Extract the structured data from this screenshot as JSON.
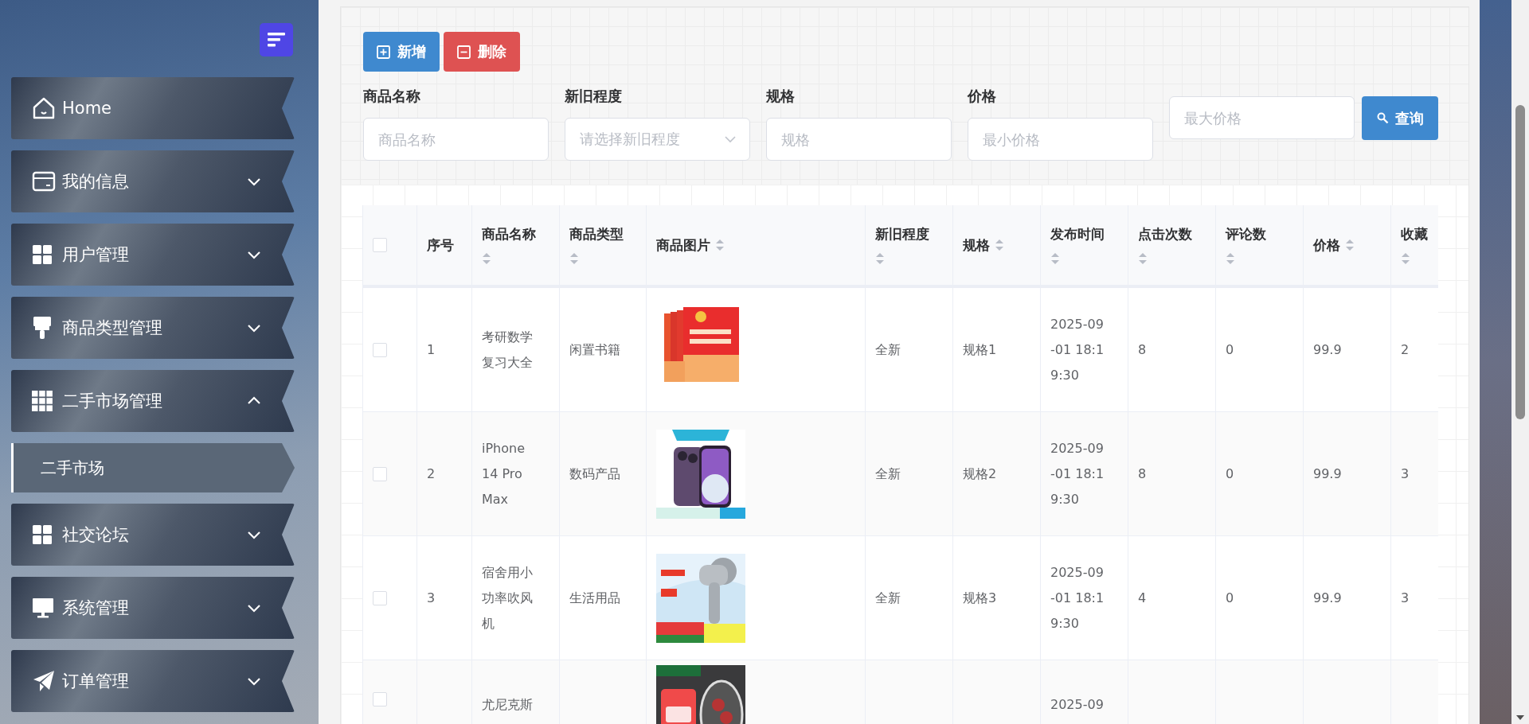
{
  "sidebar": {
    "menu": [
      {
        "label": "Home",
        "kind": "link"
      },
      {
        "label": "我的信息",
        "kind": "submenu",
        "expanded": false
      },
      {
        "label": "用户管理",
        "kind": "submenu",
        "expanded": false
      },
      {
        "label": "商品类型管理",
        "kind": "submenu",
        "expanded": false
      },
      {
        "label": "二手市场管理",
        "kind": "submenu",
        "expanded": true,
        "children": [
          {
            "label": "二手市场",
            "selected": true
          }
        ]
      },
      {
        "label": "社交论坛",
        "kind": "submenu",
        "expanded": false
      },
      {
        "label": "系统管理",
        "kind": "submenu",
        "expanded": false
      },
      {
        "label": "订单管理",
        "kind": "submenu",
        "expanded": false
      }
    ]
  },
  "toolbar": {
    "buttons": [
      {
        "label": "新增",
        "kind": "add"
      },
      {
        "label": "删除",
        "kind": "delete"
      }
    ]
  },
  "filters": [
    {
      "label": "商品名称",
      "placeholder": "商品名称",
      "kind": "text"
    },
    {
      "label": "新旧程度",
      "placeholder": "请选择新旧程度",
      "kind": "select"
    },
    {
      "label": "规格",
      "placeholder": "规格",
      "kind": "text"
    },
    {
      "label": "价格",
      "placeholder": "最小价格",
      "kind": "text"
    },
    {
      "placeholder": "最大价格",
      "kind": "text"
    }
  ],
  "search_button": "查询",
  "table": {
    "all_selected": false,
    "columns": [
      {
        "label": "序号",
        "sortable": false
      },
      {
        "label": "商品名称",
        "sortable": true
      },
      {
        "label": "商品类型",
        "sortable": true
      },
      {
        "label": "商品图片",
        "sortable": true
      },
      {
        "label": "新旧程度",
        "sortable": true
      },
      {
        "label": "规格",
        "sortable": true
      },
      {
        "label": "发布时间",
        "sortable": true
      },
      {
        "label": "点击次数",
        "sortable": true
      },
      {
        "label": "评论数",
        "sortable": true
      },
      {
        "label": "价格",
        "sortable": true
      },
      {
        "label": "收藏",
        "sortable": true
      }
    ],
    "rows": [
      {
        "selected": false,
        "cells": [
          "1",
          "考研数学复习大全",
          "闲置书籍",
          {
            "kind": "picture"
          },
          "全新",
          "规格1",
          "2025-09-01 18:19:30",
          "8",
          "0",
          "99.9",
          "2"
        ]
      },
      {
        "selected": false,
        "cells": [
          "2",
          "iPhone 14 Pro Max",
          "数码产品",
          {
            "kind": "picture"
          },
          "全新",
          "规格2",
          "2025-09-01 18:19:30",
          "8",
          "0",
          "99.9",
          "3"
        ]
      },
      {
        "selected": false,
        "cells": [
          "3",
          "宿舍用小功率吹风机",
          "生活用品",
          {
            "kind": "picture"
          },
          "全新",
          "规格3",
          "2025-09-01 18:19:30",
          "4",
          "0",
          "99.9",
          "3"
        ]
      },
      {
        "selected": false,
        "cells": [
          null,
          "尤尼克斯",
          null,
          {
            "kind": "picture"
          },
          null,
          null,
          "2025-09",
          null,
          null,
          null,
          null
        ]
      }
    ]
  }
}
